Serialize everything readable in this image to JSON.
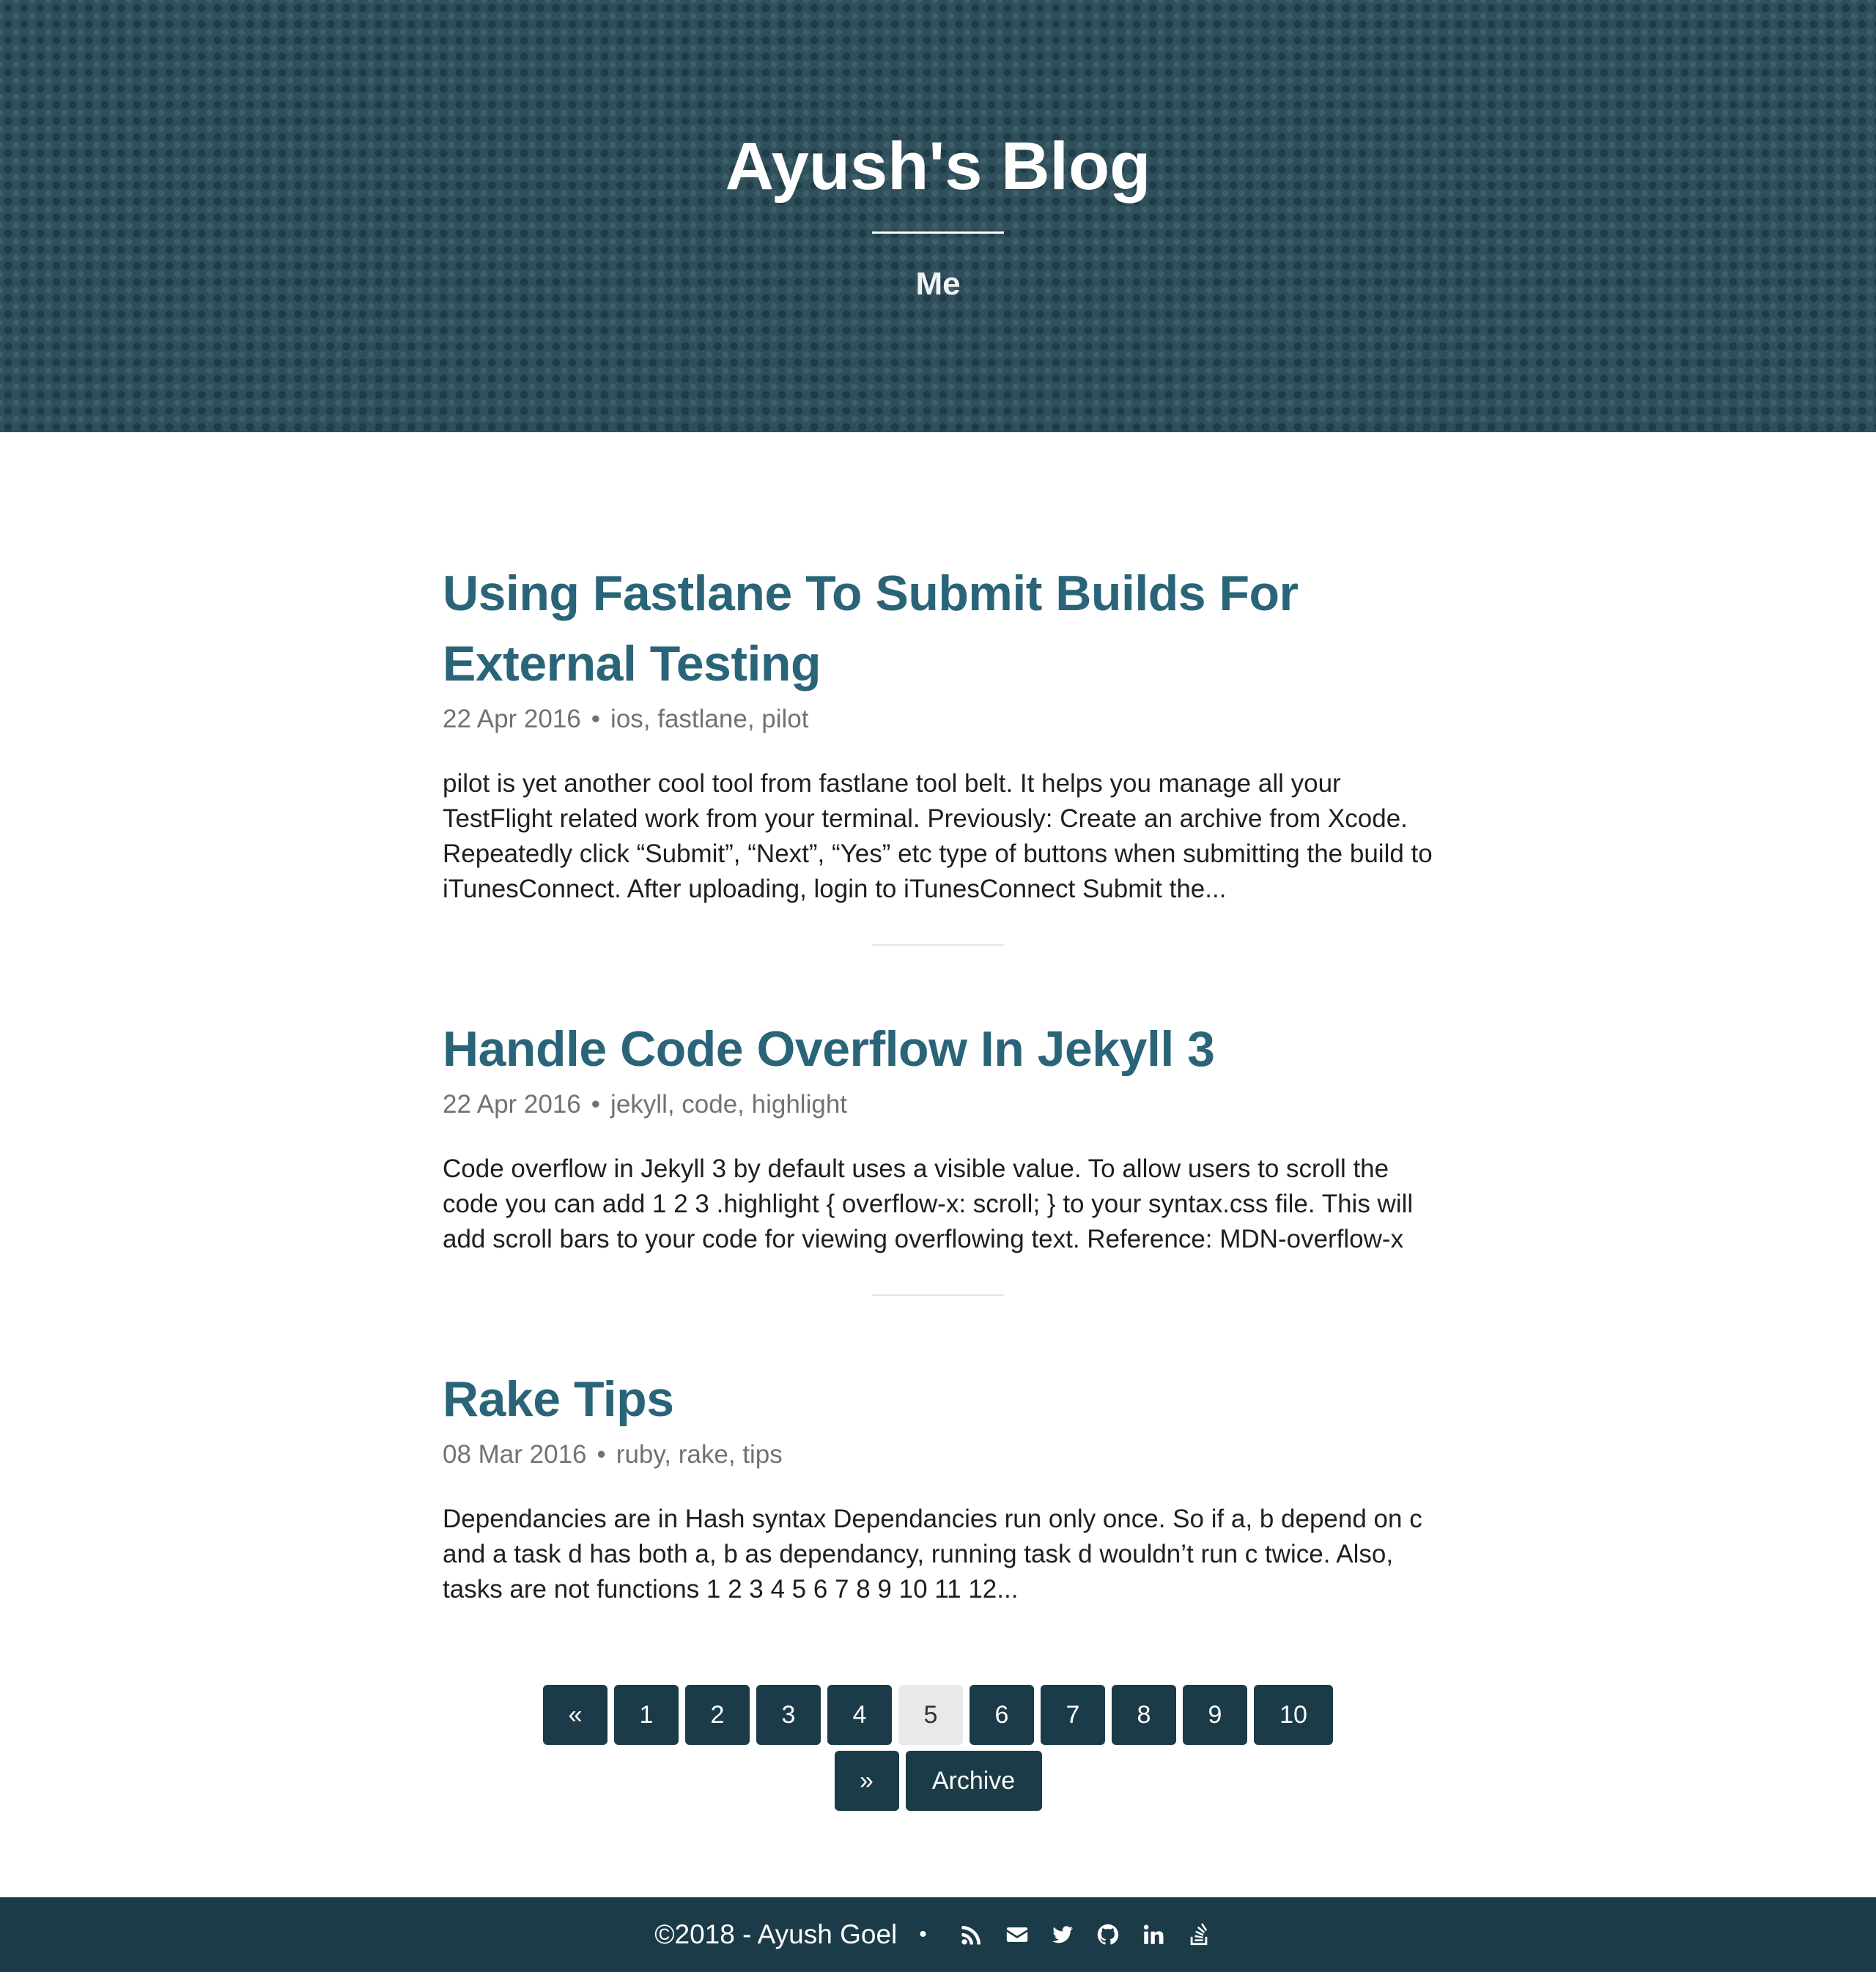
{
  "header": {
    "site_title": "Ayush's Blog",
    "nav_link": "Me"
  },
  "posts": [
    {
      "title": "Using Fastlane To Submit Builds For External Testing",
      "date": "22 Apr 2016",
      "separator": "•",
      "tags": "ios, fastlane, pilot",
      "excerpt": "pilot is yet another cool tool from fastlane tool belt. It helps you manage all your TestFlight related work from your terminal. Previously: Create an archive from Xcode. Repeatedly click “Submit”, “Next”, “Yes” etc type of buttons when submitting the build to iTunesConnect. After uploading, login to iTunesConnect Submit the..."
    },
    {
      "title": "Handle Code Overflow In Jekyll 3",
      "date": "22 Apr 2016",
      "separator": "•",
      "tags": "jekyll, code, highlight",
      "excerpt": "Code overflow in Jekyll 3 by default uses a visible value. To allow users to scroll the code you can add 1 2 3 .highlight { overflow-x: scroll; } to your syntax.css file. This will add scroll bars to your code for viewing overflowing text. Reference: MDN-overflow-x"
    },
    {
      "title": "Rake Tips",
      "date": "08 Mar 2016",
      "separator": "•",
      "tags": "ruby, rake, tips",
      "excerpt": "Dependancies are in Hash syntax Dependancies run only once. So if a, b depend on c and a task d has both a, b as dependancy, running task d wouldn’t run c twice. Also, tasks are not functions 1 2 3 4 5 6 7 8 9 10 11 12..."
    }
  ],
  "pagination": {
    "prev": "«",
    "pages": [
      "1",
      "2",
      "3",
      "4",
      "5",
      "6",
      "7",
      "8",
      "9",
      "10"
    ],
    "current_page": "5",
    "next": "»",
    "archive": "Archive"
  },
  "footer": {
    "copyright": "©2018 - Ayush Goel",
    "separator": "•",
    "icons": [
      "rss-icon",
      "email-icon",
      "twitter-icon",
      "github-icon",
      "linkedin-icon",
      "stackoverflow-icon"
    ]
  }
}
